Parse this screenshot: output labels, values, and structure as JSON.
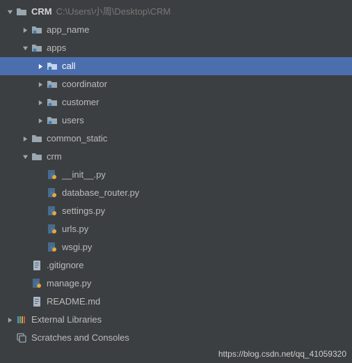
{
  "root": {
    "name": "CRM",
    "path": "C:\\Users\\小周\\Desktop\\CRM"
  },
  "tree": [
    {
      "depth": 0,
      "arrow": "down",
      "icon": "folder",
      "label": "CRM",
      "root": true
    },
    {
      "depth": 1,
      "arrow": "right",
      "icon": "package",
      "label": "app_name"
    },
    {
      "depth": 1,
      "arrow": "down",
      "icon": "package",
      "label": "apps"
    },
    {
      "depth": 2,
      "arrow": "right",
      "icon": "package",
      "label": "call",
      "selected": true
    },
    {
      "depth": 2,
      "arrow": "right",
      "icon": "package",
      "label": "coordinator"
    },
    {
      "depth": 2,
      "arrow": "right",
      "icon": "package",
      "label": "customer"
    },
    {
      "depth": 2,
      "arrow": "right",
      "icon": "package",
      "label": "users"
    },
    {
      "depth": 1,
      "arrow": "right",
      "icon": "folder",
      "label": "common_static"
    },
    {
      "depth": 1,
      "arrow": "down",
      "icon": "folder",
      "label": "crm"
    },
    {
      "depth": 2,
      "arrow": "none",
      "icon": "pyfile",
      "label": "__init__.py"
    },
    {
      "depth": 2,
      "arrow": "none",
      "icon": "pyfile",
      "label": "database_router.py"
    },
    {
      "depth": 2,
      "arrow": "none",
      "icon": "pyfile",
      "label": "settings.py"
    },
    {
      "depth": 2,
      "arrow": "none",
      "icon": "pyfile",
      "label": "urls.py"
    },
    {
      "depth": 2,
      "arrow": "none",
      "icon": "pyfile",
      "label": "wsgi.py"
    },
    {
      "depth": 1,
      "arrow": "none",
      "icon": "textfile",
      "label": ".gitignore"
    },
    {
      "depth": 1,
      "arrow": "none",
      "icon": "pyfile",
      "label": "manage.py"
    },
    {
      "depth": 1,
      "arrow": "none",
      "icon": "textfile",
      "label": "README.md"
    },
    {
      "depth": 0,
      "arrow": "right",
      "icon": "library",
      "label": "External Libraries"
    },
    {
      "depth": 0,
      "arrow": "none",
      "icon": "scratch",
      "label": "Scratches and Consoles"
    }
  ],
  "watermark": "https://blog.csdn.net/qq_41059320"
}
